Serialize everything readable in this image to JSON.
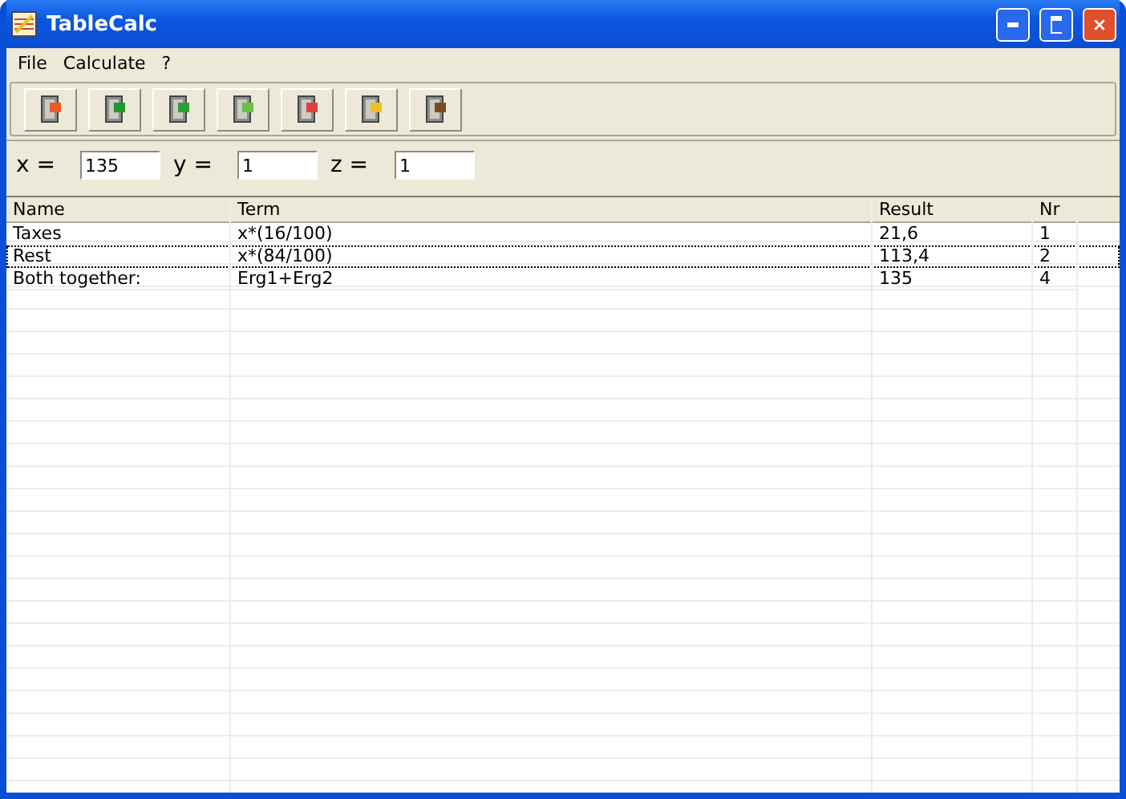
{
  "window": {
    "title": "TableCalc"
  },
  "menu": [
    "File",
    "Calculate",
    "?"
  ],
  "toolbar": [
    {
      "kind": "new"
    },
    {
      "kind": "import"
    },
    {
      "kind": "export"
    },
    {
      "kind": "add"
    },
    {
      "kind": "delete"
    },
    {
      "kind": "calculate"
    },
    {
      "kind": "exit"
    }
  ],
  "variables": [
    {
      "label": "x  =",
      "value": "135"
    },
    {
      "label": "y  =",
      "value": "1"
    },
    {
      "label": "z  =",
      "value": "1"
    }
  ],
  "table": {
    "columns": [
      "Name",
      "Term",
      "Result",
      "Nr"
    ],
    "rows": [
      {
        "cells": [
          "Taxes",
          "x*(16/100)",
          "21,6",
          "1"
        ],
        "focused": false
      },
      {
        "cells": [
          "Rest",
          "x*(84/100)",
          "113,4",
          "2"
        ],
        "focused": true
      },
      {
        "cells": [
          "Both together:",
          "Erg1+Erg2",
          "135",
          "4"
        ],
        "focused": false
      }
    ]
  }
}
